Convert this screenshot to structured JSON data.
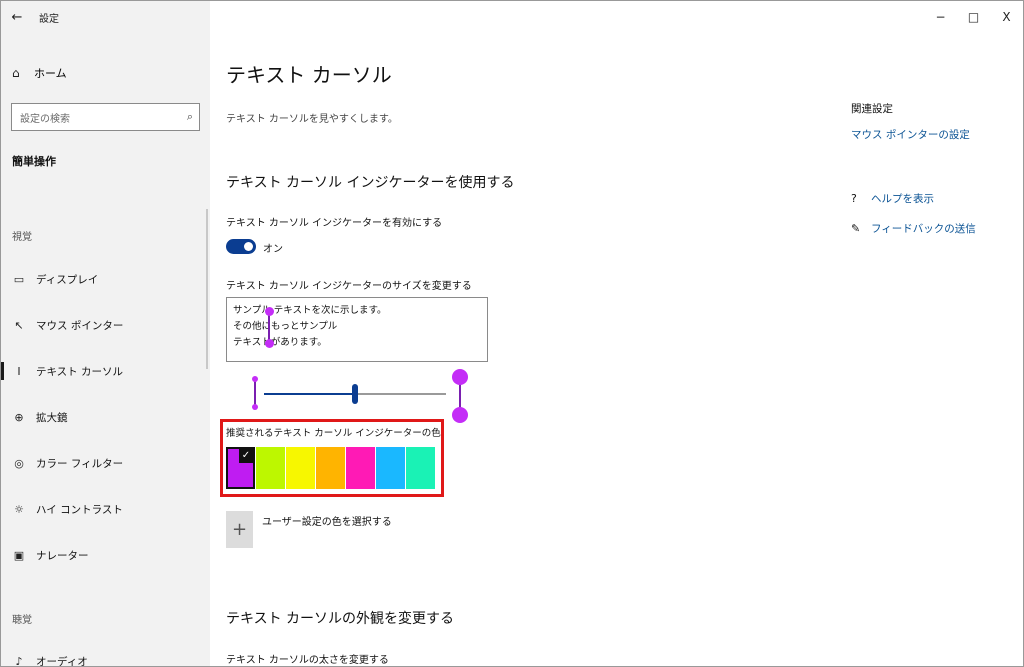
{
  "window": {
    "back_icon": "←",
    "app_title": "設定",
    "minimize": "−",
    "maximize": "□",
    "close": "X"
  },
  "sidebar": {
    "home": {
      "icon": "⌂",
      "label": "ホーム"
    },
    "search": {
      "placeholder": "設定の検索",
      "icon": "⌕"
    },
    "section": "簡単操作",
    "group_vision": "視覚",
    "group_hearing": "聴覚",
    "items": [
      {
        "icon": "▭",
        "label": "ディスプレイ"
      },
      {
        "icon": "↖",
        "label": "マウス ポインター"
      },
      {
        "icon": "I",
        "label": "テキスト カーソル"
      },
      {
        "icon": "⊕",
        "label": "拡大鏡"
      },
      {
        "icon": "◎",
        "label": "カラー フィルター"
      },
      {
        "icon": "☼",
        "label": "ハイ コントラスト"
      },
      {
        "icon": "▣",
        "label": "ナレーター"
      },
      {
        "icon": "♪",
        "label": "オーディオ"
      }
    ]
  },
  "main": {
    "title": "テキスト カーソル",
    "description": "テキスト カーソルを見やすくします。",
    "indicator_heading": "テキスト カーソル インジケーターを使用する",
    "enable_label": "テキスト カーソル インジケーターを有効にする",
    "toggle_state": "オン",
    "size_label": "テキスト カーソル インジケーターのサイズを変更する",
    "sample_lines": [
      "サンプル テキストを次に示します。",
      "その他にもっとサンプル",
      "テキストがあります。"
    ],
    "size_level": 0.5,
    "color_label": "推奨されるテキスト カーソル インジケーターの色",
    "colors": [
      "#bf1cf2",
      "#bdf700",
      "#f7f700",
      "#ffb400",
      "#ff1ab5",
      "#1ab8ff",
      "#1af2b5"
    ],
    "selected_check": "✓",
    "custom_color_label": "ユーザー設定の色を選択する",
    "add_icon": "+",
    "appearance_heading": "テキスト カーソルの外観を変更する",
    "thickness_label": "テキスト カーソルの太さを変更する"
  },
  "related": {
    "heading": "関連設定",
    "mouse_pointer_link": "マウス ポインターの設定",
    "help": {
      "icon": "?",
      "label": "ヘルプを表示"
    },
    "feedback": {
      "icon": "✎",
      "label": "フィードバックの送信"
    }
  }
}
